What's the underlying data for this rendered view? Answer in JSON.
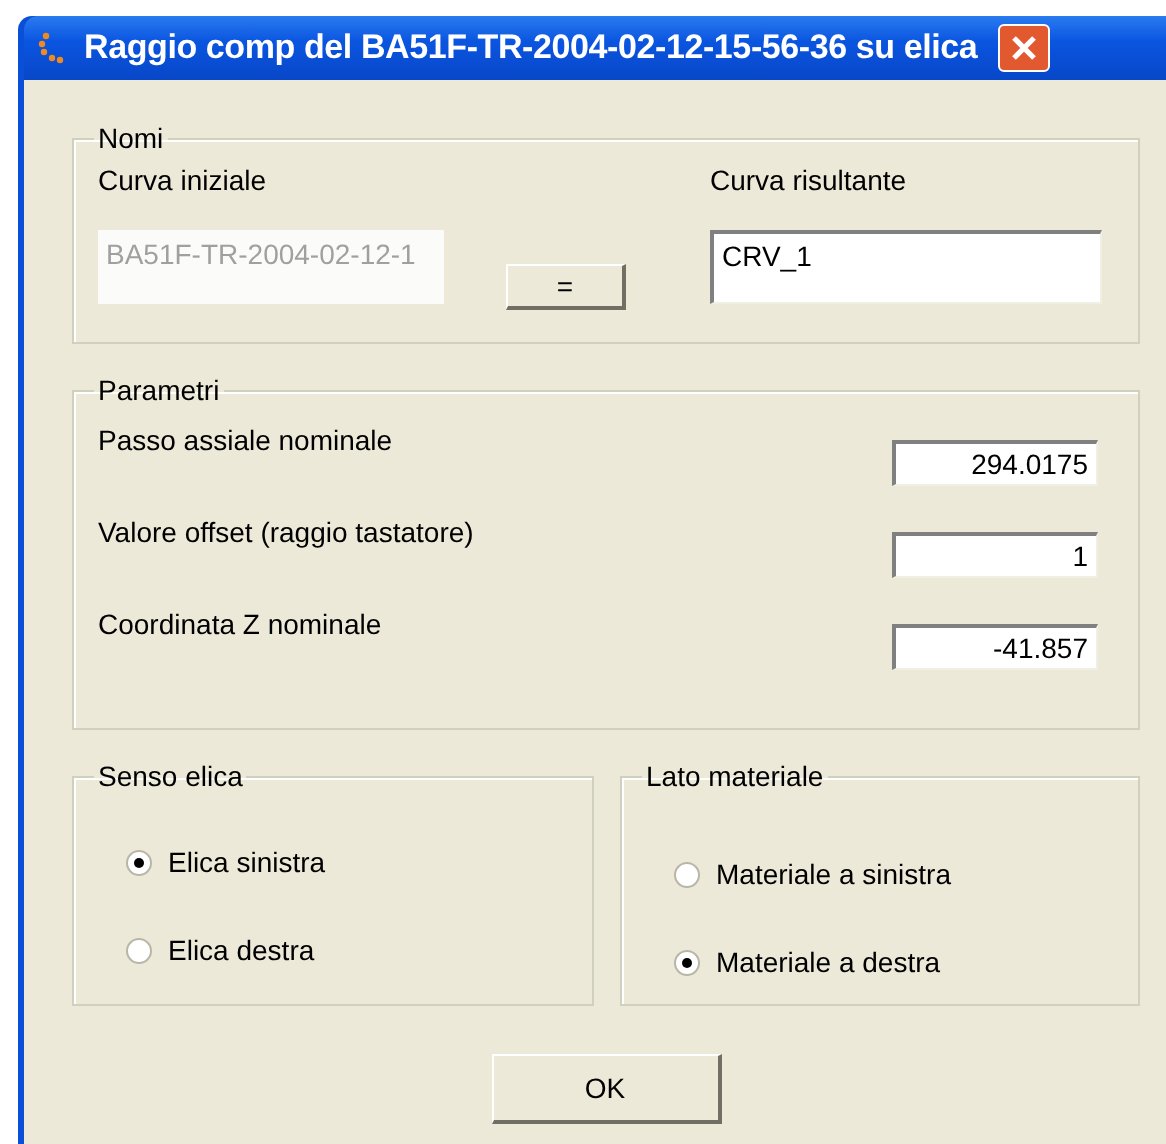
{
  "window": {
    "title": "Raggio comp del BA51F-TR-2004-02-12-15-56-36 su elica"
  },
  "nomi": {
    "legend": "Nomi",
    "initial_label": "Curva iniziale",
    "initial_value": "BA51F-TR-2004-02-12-1",
    "initial_disabled": true,
    "copy_button": "=",
    "result_label": "Curva risultante",
    "result_value": "CRV_1"
  },
  "parametri": {
    "legend": "Parametri",
    "fields": [
      {
        "label": "Passo assiale nominale",
        "value": "294.0175"
      },
      {
        "label": "Valore offset (raggio tastatore)",
        "value": "1"
      },
      {
        "label": "Coordinata Z nominale",
        "value": "-41.857"
      }
    ]
  },
  "senso_elica": {
    "legend": "Senso elica",
    "options": [
      {
        "label": "Elica sinistra",
        "selected": true
      },
      {
        "label": "Elica destra",
        "selected": false
      }
    ]
  },
  "lato_materiale": {
    "legend": "Lato materiale",
    "options": [
      {
        "label": "Materiale a sinistra",
        "selected": false
      },
      {
        "label": "Materiale a destra",
        "selected": true
      }
    ]
  },
  "ok_button": "OK"
}
